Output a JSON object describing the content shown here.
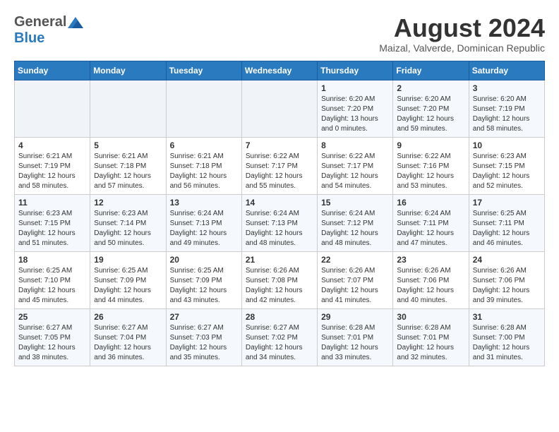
{
  "header": {
    "logo_general": "General",
    "logo_blue": "Blue",
    "title": "August 2024",
    "subtitle": "Maizal, Valverde, Dominican Republic"
  },
  "weekdays": [
    "Sunday",
    "Monday",
    "Tuesday",
    "Wednesday",
    "Thursday",
    "Friday",
    "Saturday"
  ],
  "weeks": [
    [
      {
        "num": "",
        "info": ""
      },
      {
        "num": "",
        "info": ""
      },
      {
        "num": "",
        "info": ""
      },
      {
        "num": "",
        "info": ""
      },
      {
        "num": "1",
        "info": "Sunrise: 6:20 AM\nSunset: 7:20 PM\nDaylight: 13 hours\nand 0 minutes."
      },
      {
        "num": "2",
        "info": "Sunrise: 6:20 AM\nSunset: 7:20 PM\nDaylight: 12 hours\nand 59 minutes."
      },
      {
        "num": "3",
        "info": "Sunrise: 6:20 AM\nSunset: 7:19 PM\nDaylight: 12 hours\nand 58 minutes."
      }
    ],
    [
      {
        "num": "4",
        "info": "Sunrise: 6:21 AM\nSunset: 7:19 PM\nDaylight: 12 hours\nand 58 minutes."
      },
      {
        "num": "5",
        "info": "Sunrise: 6:21 AM\nSunset: 7:18 PM\nDaylight: 12 hours\nand 57 minutes."
      },
      {
        "num": "6",
        "info": "Sunrise: 6:21 AM\nSunset: 7:18 PM\nDaylight: 12 hours\nand 56 minutes."
      },
      {
        "num": "7",
        "info": "Sunrise: 6:22 AM\nSunset: 7:17 PM\nDaylight: 12 hours\nand 55 minutes."
      },
      {
        "num": "8",
        "info": "Sunrise: 6:22 AM\nSunset: 7:17 PM\nDaylight: 12 hours\nand 54 minutes."
      },
      {
        "num": "9",
        "info": "Sunrise: 6:22 AM\nSunset: 7:16 PM\nDaylight: 12 hours\nand 53 minutes."
      },
      {
        "num": "10",
        "info": "Sunrise: 6:23 AM\nSunset: 7:15 PM\nDaylight: 12 hours\nand 52 minutes."
      }
    ],
    [
      {
        "num": "11",
        "info": "Sunrise: 6:23 AM\nSunset: 7:15 PM\nDaylight: 12 hours\nand 51 minutes."
      },
      {
        "num": "12",
        "info": "Sunrise: 6:23 AM\nSunset: 7:14 PM\nDaylight: 12 hours\nand 50 minutes."
      },
      {
        "num": "13",
        "info": "Sunrise: 6:24 AM\nSunset: 7:13 PM\nDaylight: 12 hours\nand 49 minutes."
      },
      {
        "num": "14",
        "info": "Sunrise: 6:24 AM\nSunset: 7:13 PM\nDaylight: 12 hours\nand 48 minutes."
      },
      {
        "num": "15",
        "info": "Sunrise: 6:24 AM\nSunset: 7:12 PM\nDaylight: 12 hours\nand 48 minutes."
      },
      {
        "num": "16",
        "info": "Sunrise: 6:24 AM\nSunset: 7:11 PM\nDaylight: 12 hours\nand 47 minutes."
      },
      {
        "num": "17",
        "info": "Sunrise: 6:25 AM\nSunset: 7:11 PM\nDaylight: 12 hours\nand 46 minutes."
      }
    ],
    [
      {
        "num": "18",
        "info": "Sunrise: 6:25 AM\nSunset: 7:10 PM\nDaylight: 12 hours\nand 45 minutes."
      },
      {
        "num": "19",
        "info": "Sunrise: 6:25 AM\nSunset: 7:09 PM\nDaylight: 12 hours\nand 44 minutes."
      },
      {
        "num": "20",
        "info": "Sunrise: 6:25 AM\nSunset: 7:09 PM\nDaylight: 12 hours\nand 43 minutes."
      },
      {
        "num": "21",
        "info": "Sunrise: 6:26 AM\nSunset: 7:08 PM\nDaylight: 12 hours\nand 42 minutes."
      },
      {
        "num": "22",
        "info": "Sunrise: 6:26 AM\nSunset: 7:07 PM\nDaylight: 12 hours\nand 41 minutes."
      },
      {
        "num": "23",
        "info": "Sunrise: 6:26 AM\nSunset: 7:06 PM\nDaylight: 12 hours\nand 40 minutes."
      },
      {
        "num": "24",
        "info": "Sunrise: 6:26 AM\nSunset: 7:06 PM\nDaylight: 12 hours\nand 39 minutes."
      }
    ],
    [
      {
        "num": "25",
        "info": "Sunrise: 6:27 AM\nSunset: 7:05 PM\nDaylight: 12 hours\nand 38 minutes."
      },
      {
        "num": "26",
        "info": "Sunrise: 6:27 AM\nSunset: 7:04 PM\nDaylight: 12 hours\nand 36 minutes."
      },
      {
        "num": "27",
        "info": "Sunrise: 6:27 AM\nSunset: 7:03 PM\nDaylight: 12 hours\nand 35 minutes."
      },
      {
        "num": "28",
        "info": "Sunrise: 6:27 AM\nSunset: 7:02 PM\nDaylight: 12 hours\nand 34 minutes."
      },
      {
        "num": "29",
        "info": "Sunrise: 6:28 AM\nSunset: 7:01 PM\nDaylight: 12 hours\nand 33 minutes."
      },
      {
        "num": "30",
        "info": "Sunrise: 6:28 AM\nSunset: 7:01 PM\nDaylight: 12 hours\nand 32 minutes."
      },
      {
        "num": "31",
        "info": "Sunrise: 6:28 AM\nSunset: 7:00 PM\nDaylight: 12 hours\nand 31 minutes."
      }
    ]
  ]
}
